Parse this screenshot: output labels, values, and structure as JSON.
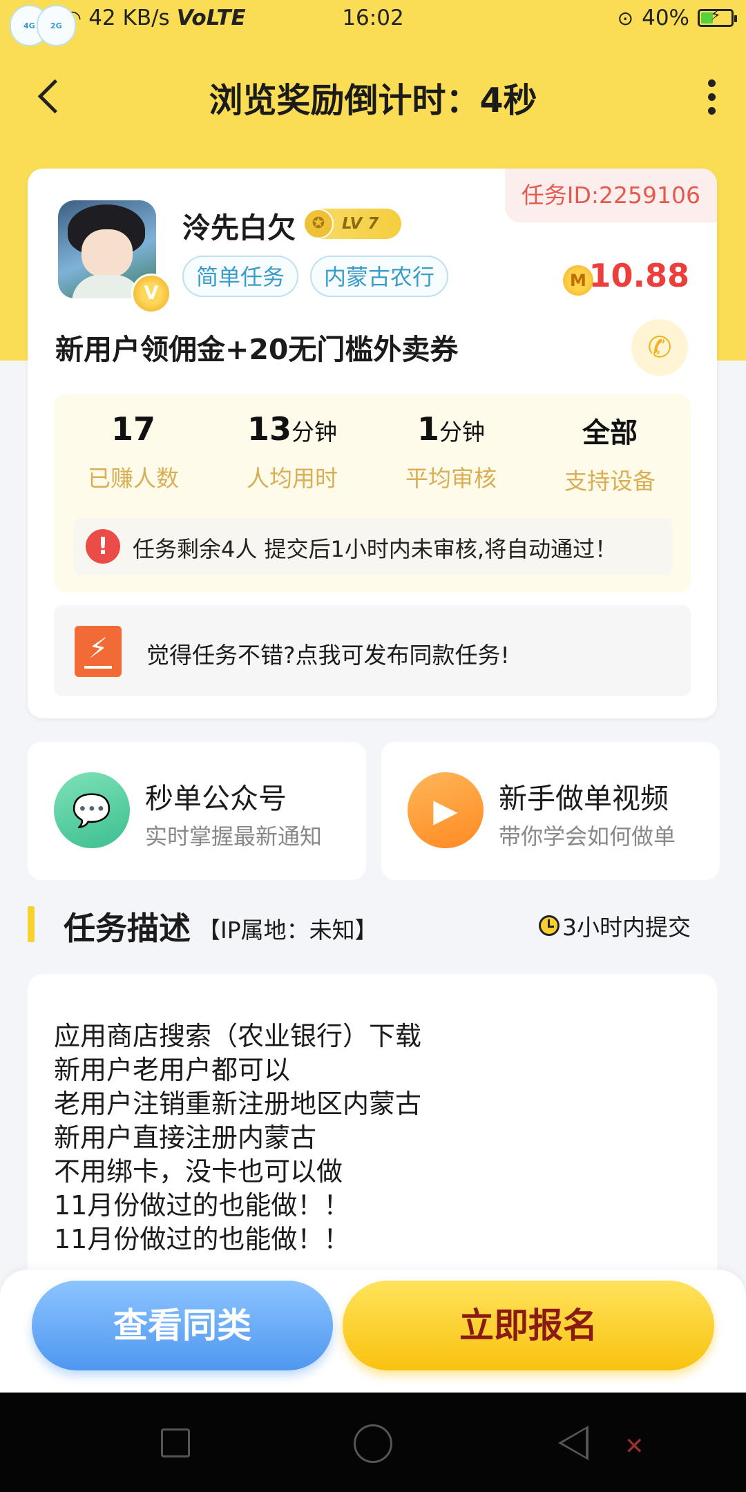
{
  "status_bar": {
    "network1": "4G",
    "network2": "2G",
    "speed": "42 KB/s",
    "volte": "VoLTE",
    "time": "16:02",
    "battery": "40%",
    "battery_level": 0.4
  },
  "nav": {
    "title": "浏览奖励倒计时：4秒"
  },
  "task": {
    "id_label": "任务ID:2259106",
    "user_name": "泠先白欠",
    "level": "LV 7",
    "verified_badge": "V",
    "tags": [
      "简单任务",
      "内蒙古农行"
    ],
    "coin_symbol": "M",
    "reward": "10.88",
    "title": "新用户领佣金+20无门槛外卖券"
  },
  "stats": [
    {
      "value": "17",
      "unit": "",
      "label": "已赚人数"
    },
    {
      "value": "13",
      "unit": "分钟",
      "label": "人均用时"
    },
    {
      "value": "1",
      "unit": "分钟",
      "label": "平均审核"
    },
    {
      "value": "全部",
      "unit": "",
      "label": "支持设备"
    }
  ],
  "notice": {
    "text": "任务剩余4人  提交后1小时内未审核,将自动通过！"
  },
  "publish": {
    "text": "觉得任务不错?点我可发布同款任务!"
  },
  "mini_cards": [
    {
      "title": "秒单公众号",
      "subtitle": "实时掌握最新通知",
      "icon": "wechat-icon"
    },
    {
      "title": "新手做单视频",
      "subtitle": "带你学会如何做单",
      "icon": "video-icon"
    }
  ],
  "description": {
    "title": "任务描述",
    "ip": "【IP属地：未知】",
    "deadline": "3小时内提交",
    "lines": [
      "应用商店搜索（农业银行）下载",
      "新用户老用户都可以",
      "老用户注销重新注册地区内蒙古",
      "新用户直接注册内蒙古",
      "不用绑卡，没卡也可以做",
      "11月份做过的也能做！！",
      "11月份做过的也能做！！"
    ]
  },
  "buttons": {
    "similar": "查看同类",
    "signup": "立即报名"
  },
  "colors": {
    "header_yellow": "#fadd55",
    "reward_red": "#ec3e3a",
    "stat_label": "#d9ae54",
    "blue_button": "#4f97f0",
    "yellow_button": "#f9c20f"
  }
}
